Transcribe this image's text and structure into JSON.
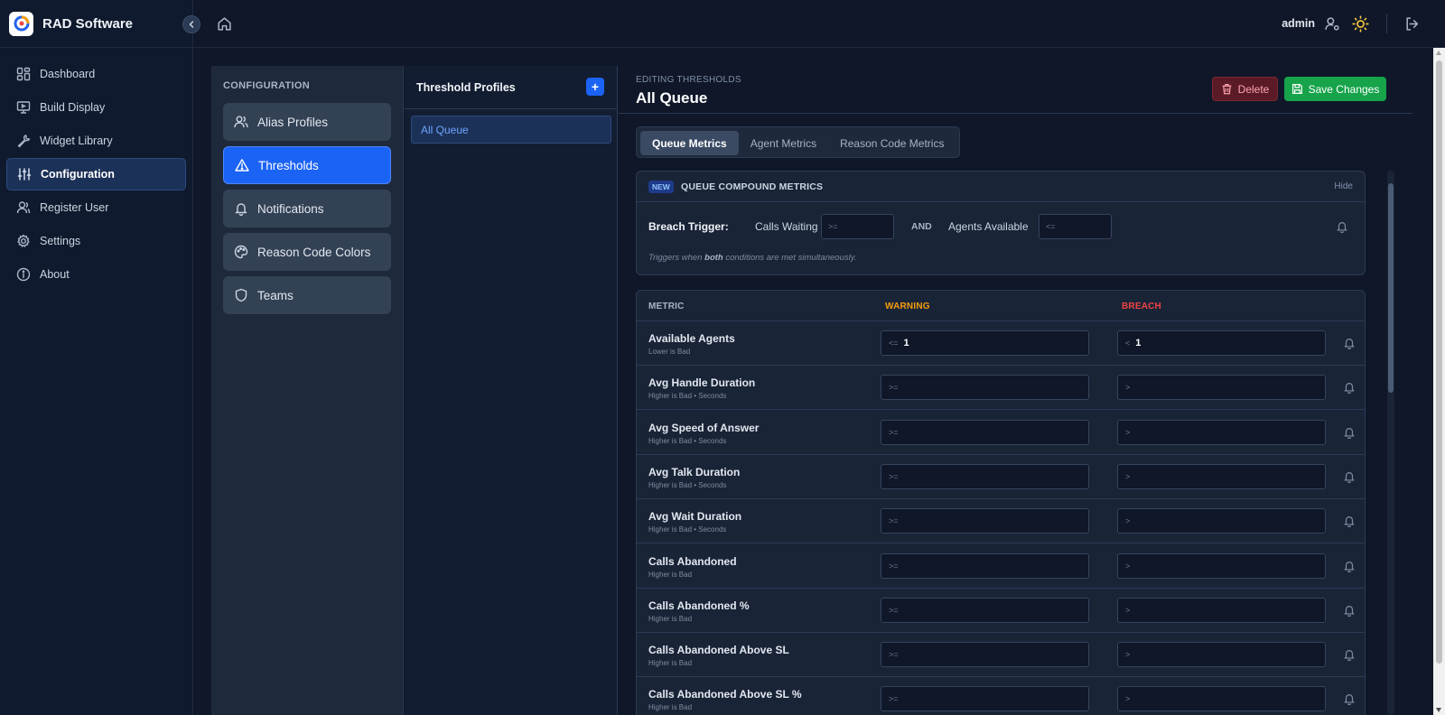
{
  "brand": {
    "name": "RAD Software"
  },
  "sidebar": {
    "items": [
      {
        "label": "Dashboard",
        "icon": "dashboard-icon"
      },
      {
        "label": "Build Display",
        "icon": "monitor-icon"
      },
      {
        "label": "Widget Library",
        "icon": "wrench-icon"
      },
      {
        "label": "Configuration",
        "icon": "sliders-icon",
        "active": true
      },
      {
        "label": "Register User",
        "icon": "user-icon"
      },
      {
        "label": "Settings",
        "icon": "gear-icon"
      },
      {
        "label": "About",
        "icon": "info-icon"
      }
    ]
  },
  "topbar": {
    "user": "admin"
  },
  "config": {
    "heading": "CONFIGURATION",
    "items": [
      {
        "label": "Alias Profiles",
        "icon": "users-icon"
      },
      {
        "label": "Thresholds",
        "icon": "warning-triangle-icon",
        "active": true
      },
      {
        "label": "Notifications",
        "icon": "bell-icon"
      },
      {
        "label": "Reason Code Colors",
        "icon": "palette-icon"
      },
      {
        "label": "Teams",
        "icon": "shield-icon"
      }
    ]
  },
  "profiles": {
    "title": "Threshold Profiles",
    "add_label": "+",
    "items": [
      "All Queue"
    ]
  },
  "editor": {
    "label": "EDITING THRESHOLDS",
    "title": "All Queue",
    "delete_label": "Delete",
    "save_label": "Save Changes",
    "tabs": [
      "Queue Metrics",
      "Agent Metrics",
      "Reason Code Metrics"
    ],
    "active_tab": "Queue Metrics"
  },
  "compound": {
    "badge": "NEW",
    "title": "QUEUE COMPOUND METRICS",
    "hide_label": "Hide",
    "trigger_label": "Breach Trigger:",
    "calls_waiting_label": "Calls Waiting",
    "calls_waiting_placeholder": ">=",
    "and_label": "AND",
    "agents_available_label": "Agents Available",
    "agents_available_placeholder": "<=",
    "note_prefix": "Triggers when",
    "note_bold": "both",
    "note_suffix": "conditions are met simultaneously."
  },
  "metrics_table": {
    "headers": {
      "metric": "METRIC",
      "warning": "WARNING",
      "breach": "BREACH"
    },
    "colors": {
      "warning": "#f59e0b",
      "breach": "#ef4444"
    },
    "rows": [
      {
        "name": "Available Agents",
        "sub": "Lower is Bad",
        "warn_op": "<=",
        "warn_val": "1",
        "breach_op": "<",
        "breach_val": "1"
      },
      {
        "name": "Avg Handle Duration",
        "sub": "Higher is Bad   • Seconds",
        "warn_op": ">=",
        "warn_val": "",
        "breach_op": ">",
        "breach_val": ""
      },
      {
        "name": "Avg Speed of Answer",
        "sub": "Higher is Bad   • Seconds",
        "warn_op": ">=",
        "warn_val": "",
        "breach_op": ">",
        "breach_val": ""
      },
      {
        "name": "Avg Talk Duration",
        "sub": "Higher is Bad   • Seconds",
        "warn_op": ">=",
        "warn_val": "",
        "breach_op": ">",
        "breach_val": ""
      },
      {
        "name": "Avg Wait Duration",
        "sub": "Higher is Bad   • Seconds",
        "warn_op": ">=",
        "warn_val": "",
        "breach_op": ">",
        "breach_val": ""
      },
      {
        "name": "Calls Abandoned",
        "sub": "Higher is Bad",
        "warn_op": ">=",
        "warn_val": "",
        "breach_op": ">",
        "breach_val": ""
      },
      {
        "name": "Calls Abandoned %",
        "sub": "Higher is Bad",
        "warn_op": ">=",
        "warn_val": "",
        "breach_op": ">",
        "breach_val": ""
      },
      {
        "name": "Calls Abandoned Above SL",
        "sub": "Higher is Bad",
        "warn_op": ">=",
        "warn_val": "",
        "breach_op": ">",
        "breach_val": ""
      },
      {
        "name": "Calls Abandoned Above SL %",
        "sub": "Higher is Bad",
        "warn_op": ">=",
        "warn_val": "",
        "breach_op": ">",
        "breach_val": ""
      }
    ]
  }
}
